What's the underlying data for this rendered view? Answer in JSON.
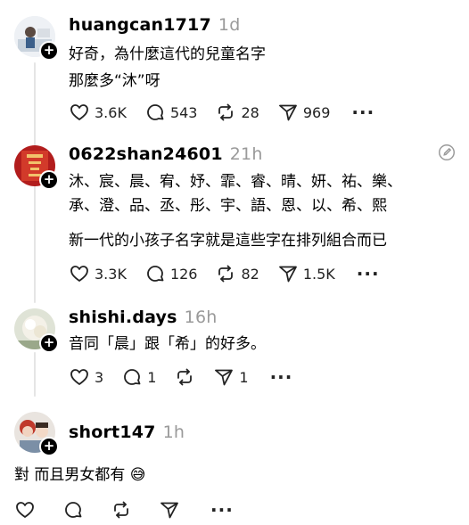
{
  "comments": [
    {
      "username": "huangcan1717",
      "time": "1d",
      "lines": [
        "好奇，為什麼這代的兒童名字",
        "那麼多“沐”呀"
      ],
      "likes": "3.6K",
      "replies": "543",
      "reposts": "28",
      "shares": "969"
    },
    {
      "username": "0622shan24601",
      "time": "21h",
      "lines": [
        "沐、宸、晨、宥、妤、霏、睿、晴、妍、祐、樂、",
        "承、澄、品、丞、彤、宇、語、恩、以、希、熙",
        "",
        "新一代的小孩子名字就是這些字在排列組合而已"
      ],
      "likes": "3.3K",
      "replies": "126",
      "reposts": "82",
      "shares": "1.5K"
    },
    {
      "username": "shishi.days",
      "time": "16h",
      "lines": [
        "音同「晨」跟「希」的好多。"
      ],
      "likes": "3",
      "replies": "1",
      "reposts": "",
      "shares": "1"
    },
    {
      "username": "short147",
      "time": "1h",
      "lines": [
        "對 而且男女都有 😅"
      ],
      "likes": "",
      "replies": "",
      "reposts": "",
      "shares": ""
    }
  ],
  "icons": {
    "like": "heart-icon",
    "reply": "comment-icon",
    "repost": "repost-icon",
    "share": "send-icon",
    "more": "more-icon",
    "edit": "edit-icon",
    "follow": "plus-icon"
  },
  "colors": {
    "text": "#000000",
    "muted": "#9a9a9a",
    "thread_line": "#e5e5e5"
  }
}
